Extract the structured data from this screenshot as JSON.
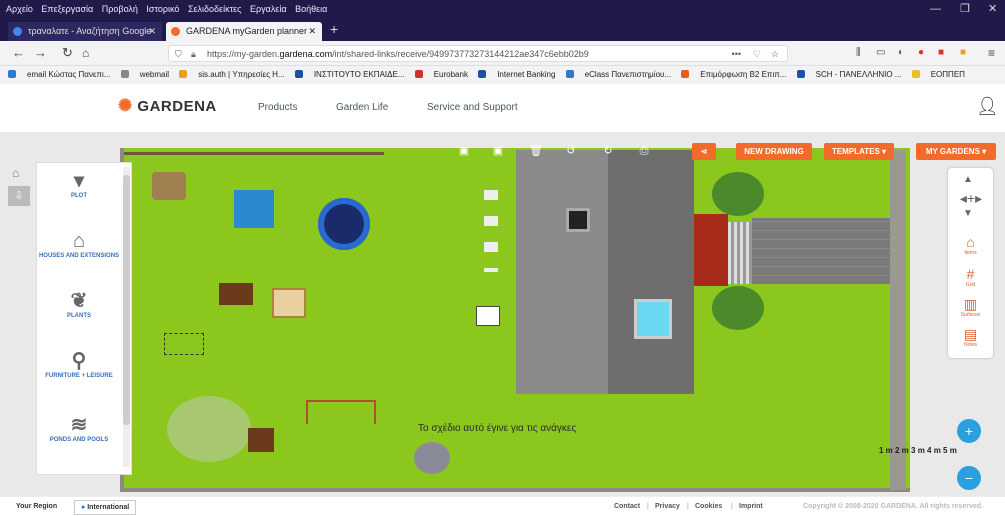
{
  "browser": {
    "menu": [
      "Αρχείο",
      "Επεξεργασία",
      "Προβολή",
      "Ιστορικό",
      "Σελιδοδείκτες",
      "Εργαλεία",
      "Βοήθεια"
    ],
    "tabs": [
      {
        "title": "τραναλατε - Αναζήτηση Google",
        "active": false
      },
      {
        "title": "GARDENA myGarden planner",
        "active": true
      }
    ],
    "new_tab": "+",
    "url_prefix": "https://my-garden.",
    "url_domain": "gardena.com",
    "url_rest": "/int/shared-links/receive/949973773273144212ae347c6ebb02b9",
    "url_more": "•••",
    "bookmarks": [
      "email Κώστας Πανεπι...",
      "webmail",
      "sis.auth | Υπηρεσίες Η...",
      "ΙΝΣΤΙΤΟΥΤΟ ΕΚΠΑΙΔΕ...",
      "Eurobank",
      "Internet Banking",
      "eClass Πανεπιστημίου...",
      "Επιμόρφωση Β2 Επιπ...",
      "SCH - ΠΑΝΕΛΛΗΝΙΟ ...",
      "ΕΟΠΠΕΠ"
    ]
  },
  "header": {
    "logo": "GARDENA",
    "nav": [
      "Products",
      "Garden Life",
      "Service and Support"
    ]
  },
  "toolbar": {
    "new_drawing": "NEW DRAWING",
    "templates": "TEMPLATES ▾",
    "my_gardens": "MY GARDENS ▾"
  },
  "sidebar": {
    "items": [
      {
        "label": "PLOT",
        "icon": "plot-icon"
      },
      {
        "label": "HOUSES AND EXTENSIONS",
        "icon": "house-icon"
      },
      {
        "label": "PLANTS",
        "icon": "leaf-icon"
      },
      {
        "label": "FURNITURE + LEISURE",
        "icon": "grill-icon"
      },
      {
        "label": "PONDS AND POOLS",
        "icon": "water-icon"
      }
    ]
  },
  "rightpanel": {
    "items": [
      {
        "label": "Items",
        "icon": "items-icon"
      },
      {
        "label": "Grid",
        "icon": "grid-icon"
      },
      {
        "label": "Surfaces",
        "icon": "surfaces-icon"
      },
      {
        "label": "Notes",
        "icon": "notes-icon"
      }
    ]
  },
  "canvas": {
    "caption": "Το σχέδιο αυτό έγινε για τις ανάγκες",
    "scale": "1 m 2 m 3 m 4 m 5 m"
  },
  "footer": {
    "region_label": "Your Region",
    "region_value": "International",
    "links": [
      "Contact",
      "Privacy",
      "Cookies",
      "Imprint"
    ],
    "copyright": "Copyright © 2008-2020 GARDENA. All rights reserved."
  },
  "colors": {
    "accent": "#f26b2a",
    "lawn": "#8bc71d",
    "browser_dark": "#201a4a",
    "link_blue": "#3a6fb5"
  }
}
